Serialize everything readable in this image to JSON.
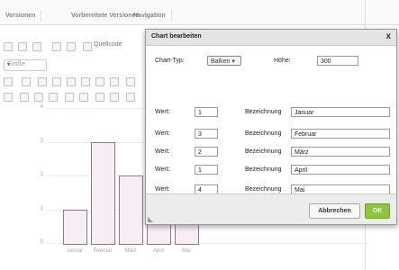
{
  "tabs": [
    "Versionen",
    "Vorbereitete Versionen",
    "Navigation"
  ],
  "toolbar": {
    "row1_text": "Quellcode",
    "row2_select": "Größe",
    "row4_hidden": ""
  },
  "chart": {
    "type": "bar",
    "categories": [
      "Januar",
      "Februar",
      "März",
      "April",
      "Mai"
    ],
    "values": [
      1,
      3,
      2,
      1,
      4
    ],
    "y_ticks": [
      "4",
      "3",
      "2",
      "1",
      "0"
    ]
  },
  "chart_data": {
    "type": "bar",
    "categories": [
      "Januar",
      "Februar",
      "März",
      "April",
      "Mai"
    ],
    "values": [
      1,
      3,
      2,
      1,
      4
    ],
    "ylim": [
      0,
      4
    ]
  },
  "dialog": {
    "title": "Chart bearbeiten",
    "close": "x",
    "chart_type_label": "Chart-Typ:",
    "chart_type_value": "Balken",
    "height_label": "Höhe:",
    "height_value": "300",
    "rows": [
      {
        "wert_label": "Wert:",
        "wert": "1",
        "bez_label": "Bezeichnung",
        "bez": "Januar"
      },
      {
        "wert_label": "Wert:",
        "wert": "3",
        "bez_label": "Bezeichnung",
        "bez": "Februar"
      },
      {
        "wert_label": "Wert:",
        "wert": "2",
        "bez_label": "Bezeichnung",
        "bez": "März"
      },
      {
        "wert_label": "Wert:",
        "wert": "1",
        "bez_label": "Bezeichnung",
        "bez": "April"
      },
      {
        "wert_label": "Wert:",
        "wert": "4",
        "bez_label": "Bezeichnung",
        "bez": "Mai"
      }
    ],
    "cancel": "Abbrechen",
    "ok": "OK"
  }
}
